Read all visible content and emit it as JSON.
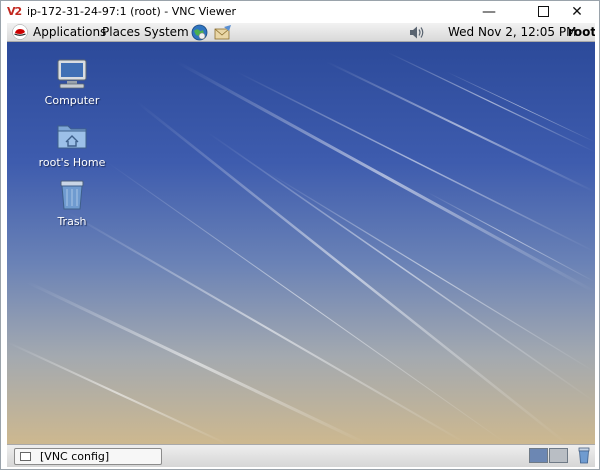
{
  "window": {
    "logo_text": "V2",
    "title": "ip-172-31-24-97:1 (root) - VNC Viewer",
    "minimize": "—",
    "close": "✕"
  },
  "panel": {
    "applications": "Applications",
    "places": "Places",
    "system": "System",
    "clock": "Wed Nov  2, 12:05 PM",
    "user": "root",
    "icons": [
      "redhat-icon",
      "browser-icon",
      "mail-icon",
      "volume-icon"
    ]
  },
  "desktop": {
    "icons": [
      {
        "label": "Computer",
        "icon": "computer-icon"
      },
      {
        "label": "root's Home",
        "icon": "home-folder-icon"
      },
      {
        "label": "Trash",
        "icon": "trash-icon"
      }
    ]
  },
  "taskbar": {
    "task_label": "[VNC config]",
    "workspaces": [
      "workspace-1",
      "workspace-2"
    ]
  },
  "colors": {
    "desktop_top": "#2c4a9a",
    "desktop_bottom": "#cdb88f",
    "panel": "#e4e4e4"
  }
}
